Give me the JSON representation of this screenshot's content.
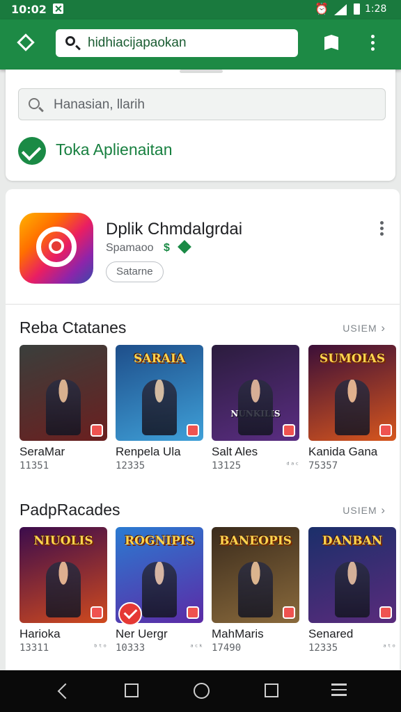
{
  "status_bar": {
    "time": "10:02",
    "battery_text": "1:28"
  },
  "top_search": {
    "query": "hidhiacijapaokan"
  },
  "search_card": {
    "placeholder": "Hanasian, llarih",
    "verified_label": "Toka Aplienaitan"
  },
  "app": {
    "title": "Dplik Chmdalgrdai",
    "developer": "Spamaoo",
    "chip": "Satarne"
  },
  "sections": [
    {
      "title": "Reba Ctatanes",
      "more": "USIEM",
      "items": [
        {
          "name": "SeraMar",
          "count": "11351",
          "banner": "",
          "colors": [
            "#3a3f3c",
            "#6b1f1f"
          ]
        },
        {
          "name": "Renpela Ula",
          "count": "12335",
          "banner": "SARAIA",
          "colors": [
            "#1e4e8a",
            "#3fa0d8"
          ]
        },
        {
          "name": "Salt Ales",
          "count": "13125",
          "banner": "",
          "tag": "NUNKILIS",
          "pill": "ᵈᵃᶜ",
          "colors": [
            "#2b1c3d",
            "#5a2d82"
          ]
        },
        {
          "name": "Kanida Gana",
          "count": "75357",
          "banner": "SUMOIAS",
          "colors": [
            "#3b0f38",
            "#d7561d"
          ]
        }
      ]
    },
    {
      "title": "PadpRacades",
      "more": "USIEM",
      "items": [
        {
          "name": "Harioka",
          "count": "13311",
          "banner": "NIUOLIS",
          "pill": "ᵇᵗᵒ",
          "colors": [
            "#3b0c4c",
            "#d04a1e"
          ]
        },
        {
          "name": "Ner Uergr",
          "count": "10333",
          "banner": "ROGNIPIS",
          "pill": "ᵃᶜᵏ",
          "colors": [
            "#2b7bd1",
            "#5c2aa6"
          ]
        },
        {
          "name": "MahMaris",
          "count": "17490",
          "banner": "BANEOPIS",
          "colors": [
            "#3a2b1c",
            "#8a6a3c"
          ]
        },
        {
          "name": "Senared",
          "count": "12335",
          "banner": "DANBAN",
          "pill": "ᵃᵗᵒ",
          "colors": [
            "#1b2f6a",
            "#5a2b7c"
          ]
        }
      ]
    }
  ],
  "colors": {
    "primary": "#1d8a45",
    "status_bar": "#1a7a3e",
    "accent_text": "#188040"
  }
}
